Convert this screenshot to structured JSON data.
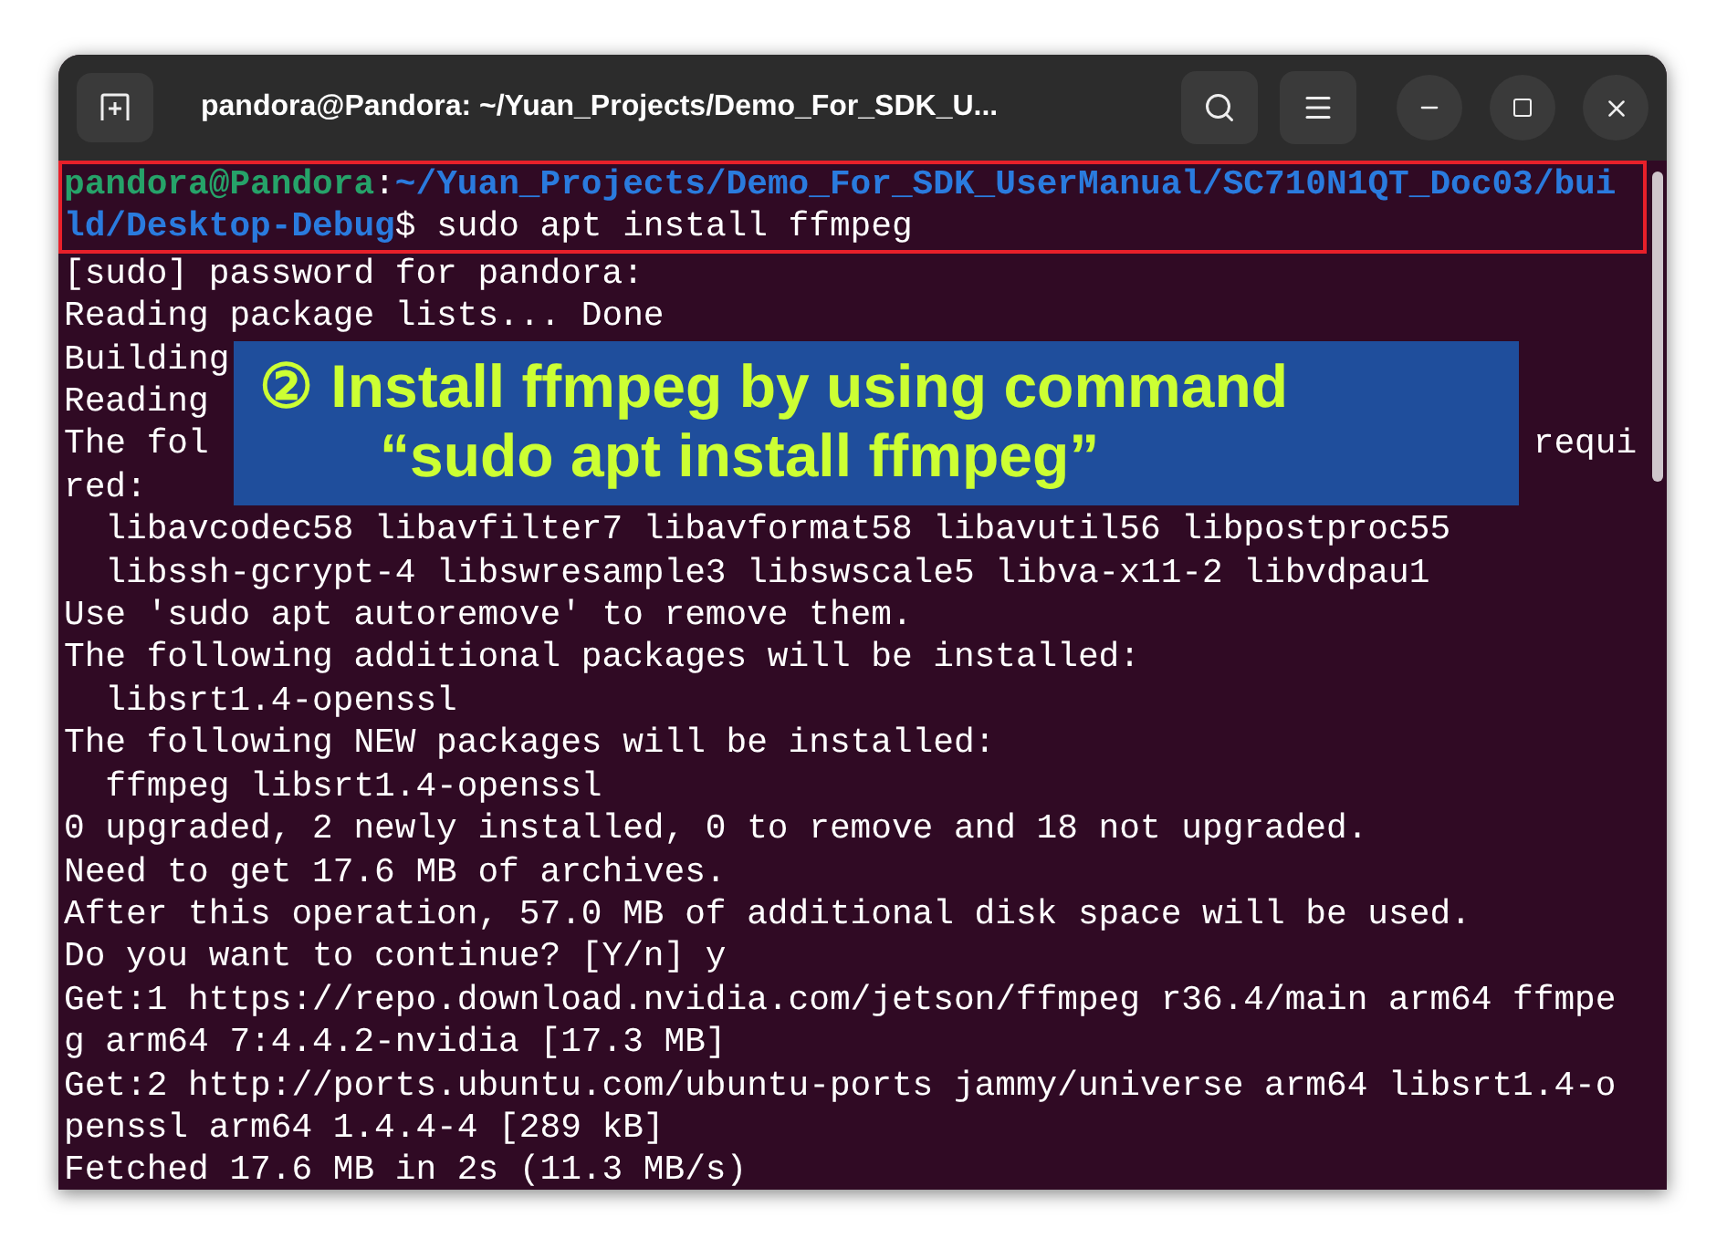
{
  "window": {
    "title": "pandora@Pandora: ~/Yuan_Projects/Demo_For_SDK_U..."
  },
  "terminal": {
    "prompt": {
      "user": "pandora@Pandora",
      "separator": ":",
      "path": "~/Yuan_Projects/Demo_For_SDK_UserManual/SC710N1QT_Doc03/build/Desktop-Debug",
      "symbol": "$",
      "command": " sudo apt install ffmpeg"
    },
    "lines": [
      {
        "kind": "text",
        "text": "[sudo] password for pandora:"
      },
      {
        "kind": "text",
        "text": "Reading package lists... Done"
      },
      {
        "kind": "covered",
        "start": "Building"
      },
      {
        "kind": "covered",
        "start": "Reading"
      },
      {
        "kind": "covered",
        "start": "The fol",
        "end": "requi"
      },
      {
        "kind": "text",
        "text": "red:"
      },
      {
        "kind": "text",
        "text": "  libavcodec58 libavfilter7 libavformat58 libavutil56 libpostproc55"
      },
      {
        "kind": "text",
        "text": "  libssh-gcrypt-4 libswresample3 libswscale5 libva-x11-2 libvdpau1"
      },
      {
        "kind": "text",
        "text": "Use 'sudo apt autoremove' to remove them."
      },
      {
        "kind": "text",
        "text": "The following additional packages will be installed:"
      },
      {
        "kind": "text",
        "text": "  libsrt1.4-openssl"
      },
      {
        "kind": "text",
        "text": "The following NEW packages will be installed:"
      },
      {
        "kind": "text",
        "text": "  ffmpeg libsrt1.4-openssl"
      },
      {
        "kind": "text",
        "text": "0 upgraded, 2 newly installed, 0 to remove and 18 not upgraded."
      },
      {
        "kind": "text",
        "text": "Need to get 17.6 MB of archives."
      },
      {
        "kind": "text",
        "text": "After this operation, 57.0 MB of additional disk space will be used."
      },
      {
        "kind": "text",
        "text": "Do you want to continue? [Y/n] y"
      },
      {
        "kind": "text",
        "text": "Get:1 https://repo.download.nvidia.com/jetson/ffmpeg r36.4/main arm64 ffmpe"
      },
      {
        "kind": "text",
        "text": "g arm64 7:4.4.2-nvidia [17.3 MB]"
      },
      {
        "kind": "text",
        "text": "Get:2 http://ports.ubuntu.com/ubuntu-ports jammy/universe arm64 libsrt1.4-o"
      },
      {
        "kind": "text",
        "text": "penssl arm64 1.4.4-4 [289 kB]"
      },
      {
        "kind": "text",
        "text": "Fetched 17.6 MB in 2s (11.3 MB/s)"
      }
    ]
  },
  "annotation": {
    "lines": [
      "② Install ffmpeg by using command",
      "“sudo apt install ffmpeg”"
    ]
  }
}
